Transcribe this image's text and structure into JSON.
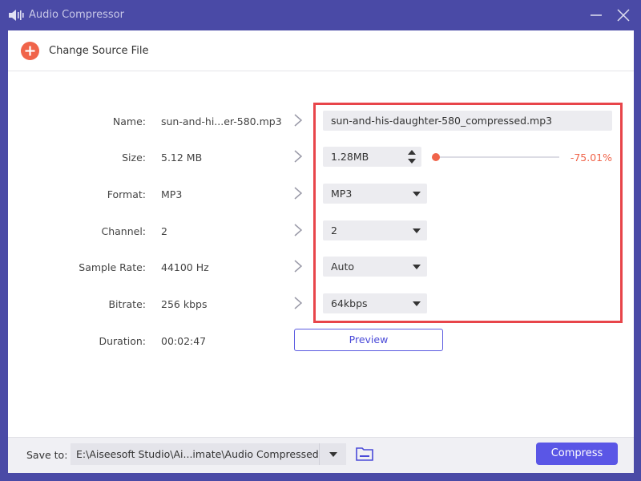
{
  "window": {
    "title": "Audio Compressor",
    "icon": "audio-speaker-icon",
    "accent_color": "#4a4aa6"
  },
  "toolbar": {
    "change_source_label": "Change Source File",
    "add_icon": "plus-icon",
    "add_color": "#f0644a"
  },
  "source": {
    "name_label": "Name:",
    "name_value": "sun-and-hi...er-580.mp3",
    "size_label": "Size:",
    "size_value": "5.12 MB",
    "format_label": "Format:",
    "format_value": "MP3",
    "channel_label": "Channel:",
    "channel_value": "2",
    "sample_rate_label": "Sample Rate:",
    "sample_rate_value": "44100 Hz",
    "bitrate_label": "Bitrate:",
    "bitrate_value": "256 kbps",
    "duration_label": "Duration:",
    "duration_value": "00:02:47"
  },
  "output": {
    "name": "sun-and-his-daughter-580_compressed.mp3",
    "size": "1.28MB",
    "size_percent": "-75.01%",
    "slider_level_percent": 0,
    "format": "MP3",
    "channel": "2",
    "sample_rate": "Auto",
    "bitrate": "64kbps",
    "highlight_color": "#e8454a"
  },
  "preview_label": "Preview",
  "footer": {
    "save_to_label": "Save to:",
    "save_path": "E:\\Aiseesoft Studio\\Ai...imate\\Audio Compressed",
    "compress_label": "Compress",
    "compress_color": "#5a56e6"
  }
}
